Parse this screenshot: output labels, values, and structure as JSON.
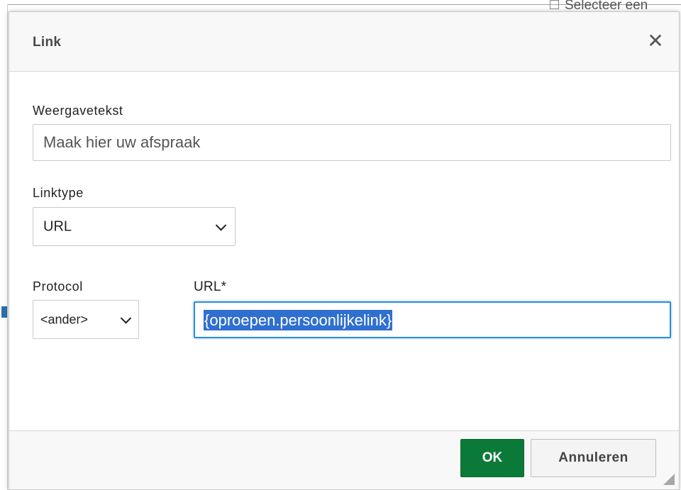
{
  "background": {
    "select_label": "Selecteer een"
  },
  "dialog": {
    "title": "Link",
    "close_glyph": "✕"
  },
  "form": {
    "display_text_label": "Weergavetekst",
    "display_text_value": "Maak hier uw afspraak",
    "link_type_label": "Linktype",
    "link_type_value": "URL",
    "protocol_label": "Protocol",
    "protocol_value": "<ander>",
    "url_label": "URL*",
    "url_value": "{oproepen.persoonlijkelink}"
  },
  "footer": {
    "ok_label": "OK",
    "cancel_label": "Annuleren"
  },
  "colors": {
    "ok_button": "#0b7a38",
    "focus_border": "#2d8de0",
    "selection": "#2f6fd0"
  }
}
